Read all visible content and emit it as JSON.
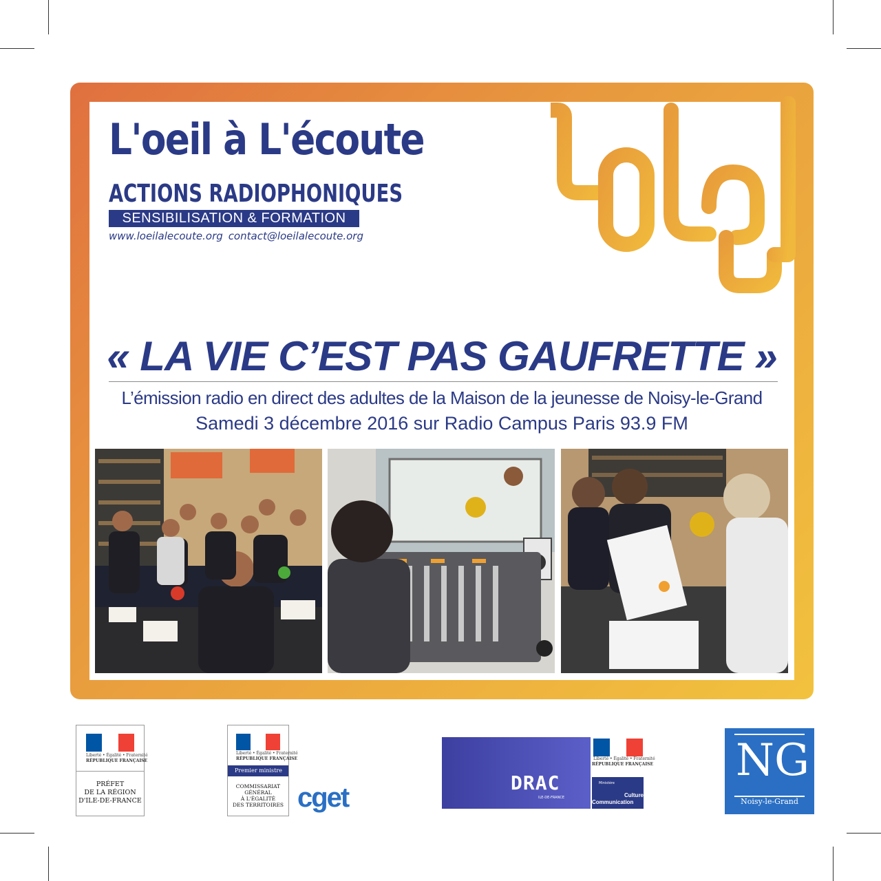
{
  "brand": {
    "name": "L'oeil à L'écoute",
    "tagline": "ACTIONS RADIOPHONIQUES",
    "bar": "SENSIBILISATION & FORMATION",
    "website": "www.loeilalecoute.org",
    "email": "contact@loeilalecoute.org",
    "logo_letters": "lole"
  },
  "event": {
    "title": "« LA VIE C’EST PAS GAUFRETTE »",
    "subtitle": "L’émission radio en direct des adultes de la Maison de la jeunesse de Noisy-le-Grand",
    "date_line": "Samedi 3 décembre 2016 sur Radio Campus Paris 93.9 FM"
  },
  "footer": {
    "prefet": {
      "motto": "Liberté • Égalité • Fraternité",
      "republic": "RÉPUBLIQUE FRANÇAISE",
      "line1": "PRÉFET",
      "line2": "DE LA RÉGION",
      "line3": "D'ILE-DE-FRANCE"
    },
    "cget": {
      "motto": "Liberté • Égalité • Fraternité",
      "republic": "RÉPUBLIQUE FRANÇAISE",
      "band": "Premier ministre",
      "line1": "COMMISSARIAT",
      "line2": "GÉNÉRAL",
      "line3": "À L'ÉGALITÉ",
      "line4": "DES TERRITOIRES",
      "wordmark": "cget"
    },
    "drac": {
      "name": "DRAC",
      "region": "ILE-DE-FRANCE",
      "motto": "Liberté • Égalité • Fraternité",
      "republic": "RÉPUBLIQUE FRANÇAISE",
      "ministere": "Ministère",
      "culture": "Culture",
      "communication": "Communication"
    },
    "noisy": {
      "letters": "NG",
      "name": "Noisy-le-Grand"
    }
  },
  "colors": {
    "navy": "#2b3a86",
    "frame_start": "#e0703f",
    "frame_end": "#f2c23e",
    "logo_gold": "#e9a83a",
    "flag_blue": "#0055a4",
    "flag_red": "#ef4135"
  }
}
